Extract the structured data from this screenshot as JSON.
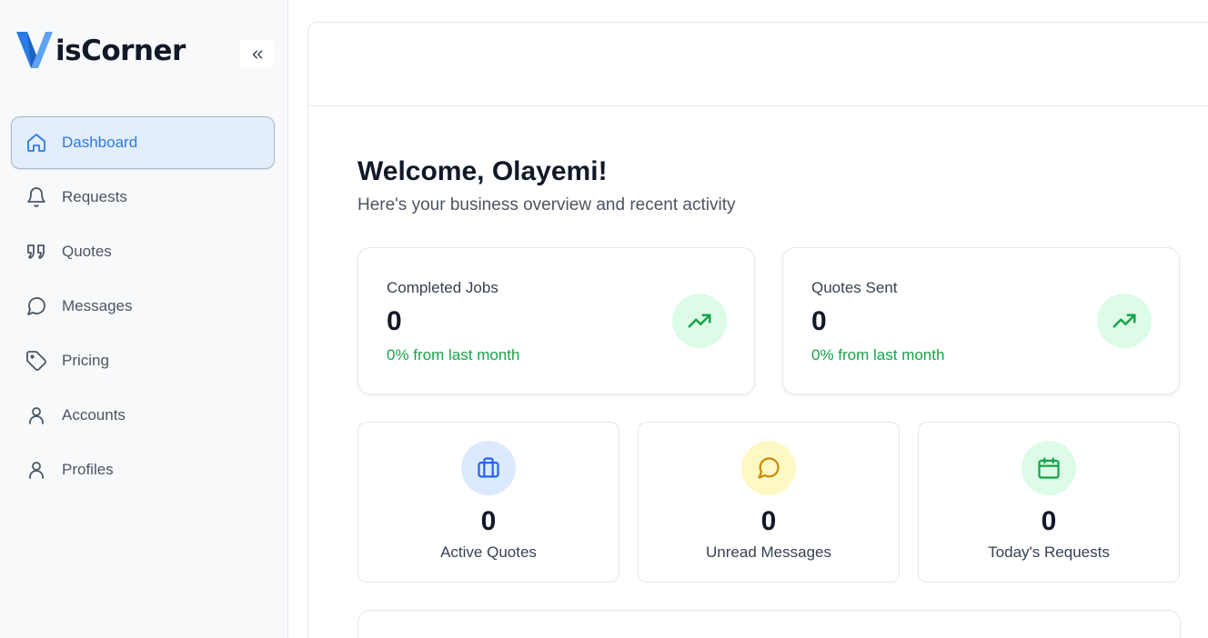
{
  "brand": {
    "logo_text": "isCorner",
    "logo_mark": "V",
    "accent": "#2b7be4"
  },
  "sidebar": {
    "items": [
      {
        "label": "Dashboard",
        "icon": "home-icon",
        "active": true
      },
      {
        "label": "Requests",
        "icon": "bell-icon"
      },
      {
        "label": "Quotes",
        "icon": "quote-icon"
      },
      {
        "label": "Messages",
        "icon": "message-icon"
      },
      {
        "label": "Pricing",
        "icon": "tag-icon"
      },
      {
        "label": "Accounts",
        "icon": "user-icon"
      },
      {
        "label": "Profiles",
        "icon": "user-icon"
      }
    ]
  },
  "main": {
    "welcome": "Welcome, Olayemi!",
    "subtitle": "Here's your business overview and recent activity",
    "stats": [
      {
        "label": "Completed Jobs",
        "value": "0",
        "change": "0% from last month",
        "icon": "trending-up-icon"
      },
      {
        "label": "Quotes Sent",
        "value": "0",
        "change": "0% from last month",
        "icon": "trending-up-icon"
      }
    ],
    "mini_stats": [
      {
        "label": "Active Quotes",
        "value": "0",
        "icon": "briefcase-icon",
        "color": "#2563eb",
        "bg": "#dbeafe"
      },
      {
        "label": "Unread Messages",
        "value": "0",
        "icon": "message-icon",
        "color": "#ca8a04",
        "bg": "#fef9c3"
      },
      {
        "label": "Today's Requests",
        "value": "0",
        "icon": "calendar-icon",
        "color": "#16a34a",
        "bg": "#dcfce7"
      }
    ]
  }
}
